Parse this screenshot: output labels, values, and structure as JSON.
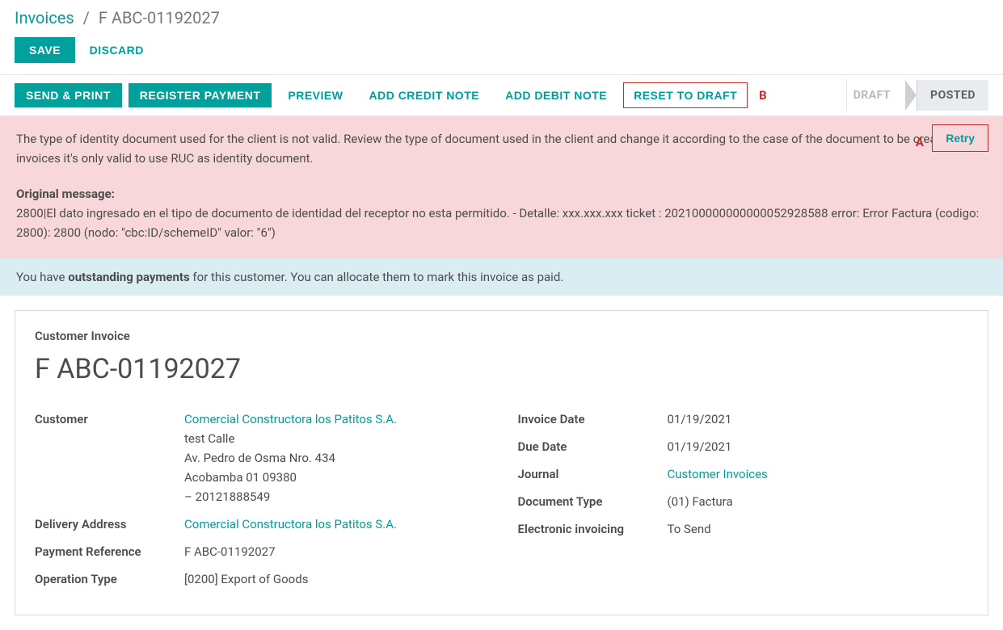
{
  "breadcrumb": {
    "parent": "Invoices",
    "sep": "/",
    "current": "F ABC-01192027"
  },
  "crud": {
    "save": "SAVE",
    "discard": "DISCARD"
  },
  "toolbar": {
    "send_print": "SEND & PRINT",
    "register_payment": "REGISTER PAYMENT",
    "preview": "PREVIEW",
    "add_credit": "ADD CREDIT NOTE",
    "add_debit": "ADD DEBIT NOTE",
    "reset_draft": "RESET TO DRAFT",
    "marker_b": "B"
  },
  "status": {
    "draft": "DRAFT",
    "posted": "POSTED"
  },
  "error": {
    "main": "The type of identity document used for the client is not valid. Review the type of document used in the client and change it according to the case of the document to be created. For invoices it's only valid to use RUC as identity document.",
    "orig_label": "Original message:",
    "orig_body": "2800|El dato ingresado en el tipo de documento de identidad del receptor no esta permitido. - Detalle: xxx.xxx.xxx ticket : 202100000000000052928588 error: Error Factura (codigo: 2800): 2800 (nodo: \"cbc:ID/schemeID\" valor: \"6\")",
    "marker_a": "A",
    "retry": "Retry"
  },
  "info": {
    "pre": "You have ",
    "bold": "outstanding payments",
    "post": " for this customer. You can allocate them to mark this invoice as paid."
  },
  "sheet": {
    "label": "Customer Invoice",
    "title": "F ABC-01192027",
    "left": {
      "customer_label": "Customer",
      "customer_link": "Comercial Constructora los Patitos S.A.",
      "addr1": "test Calle",
      "addr2": "Av. Pedro de Osma Nro. 434",
      "addr3": "Acobamba 01 09380",
      "addr4": "– 20121888549",
      "delivery_label": "Delivery Address",
      "delivery_link": "Comercial Constructora los Patitos S.A.",
      "payref_label": "Payment Reference",
      "payref_val": "F ABC-01192027",
      "optype_label": "Operation Type",
      "optype_val": "[0200] Export of Goods"
    },
    "right": {
      "invdate_label": "Invoice Date",
      "invdate_val": "01/19/2021",
      "duedate_label": "Due Date",
      "duedate_val": "01/19/2021",
      "journal_label": "Journal",
      "journal_link": "Customer Invoices",
      "doctype_label": "Document Type",
      "doctype_val": "(01) Factura",
      "einv_label": "Electronic invoicing",
      "einv_val": "To Send"
    }
  }
}
